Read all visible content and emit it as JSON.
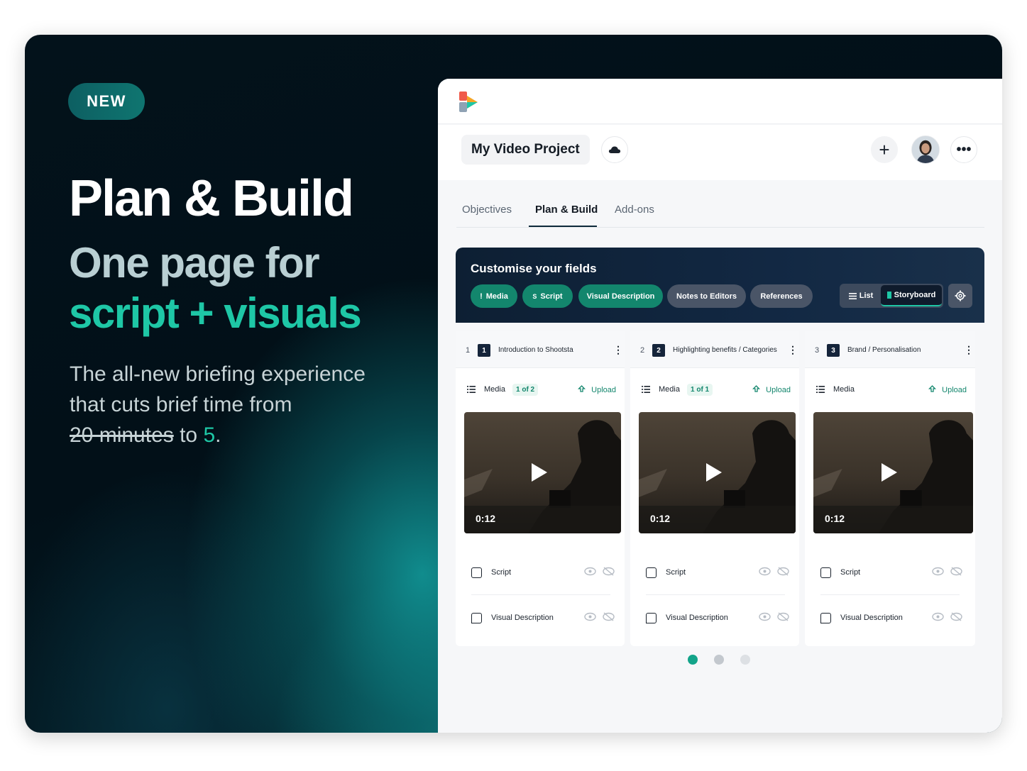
{
  "hero": {
    "badge": "NEW",
    "headline": "Plan & Build",
    "subline_1": "One page for",
    "subline_2": "script + visuals",
    "description_line1": "The all-new briefing experience",
    "description_line2": "that cuts brief time from",
    "old_time": "20 minutes",
    "to_word": "to",
    "new_time": "5",
    "period": "."
  },
  "app": {
    "project_title": "My Video Project",
    "tabs": [
      {
        "label": "Objectives",
        "active": false
      },
      {
        "label": "Plan & Build",
        "active": true
      },
      {
        "label": "Add-ons",
        "active": false
      }
    ],
    "customise": {
      "title": "Customise your fields",
      "chips": [
        {
          "label": "Media",
          "icon": "!",
          "enabled": true
        },
        {
          "label": "Script",
          "icon": "S",
          "enabled": true
        },
        {
          "label": "Visual Description",
          "icon": "",
          "enabled": true
        },
        {
          "label": "Notes to Editors",
          "icon": "",
          "enabled": false
        },
        {
          "label": "References",
          "icon": "",
          "enabled": false
        }
      ],
      "view_list": "List",
      "view_storyboard": "Storyboard"
    },
    "scenes": [
      {
        "index": "1",
        "number": "1",
        "title": "Introduction to Shootsta",
        "media_label": "Media",
        "media_count": "1 of 2",
        "upload": "Upload",
        "duration": "0:12",
        "script_label": "Script",
        "visual_label": "Visual Description"
      },
      {
        "index": "2",
        "number": "2",
        "title": "Highlighting benefits / Categories",
        "media_label": "Media",
        "media_count": "1 of 1",
        "upload": "Upload",
        "duration": "0:12",
        "script_label": "Script",
        "visual_label": "Visual Description"
      },
      {
        "index": "3",
        "number": "3",
        "title": "Brand / Personalisation",
        "media_label": "Media",
        "media_count": "",
        "upload": "Upload",
        "duration": "0:12",
        "script_label": "Script",
        "visual_label": "Visual Description"
      }
    ],
    "pagination": {
      "pages": 3,
      "active": 1
    }
  },
  "colors": {
    "accent": "#1ec7a6",
    "chip_on": "#13866d",
    "dark_navy": "#0d1f33"
  }
}
